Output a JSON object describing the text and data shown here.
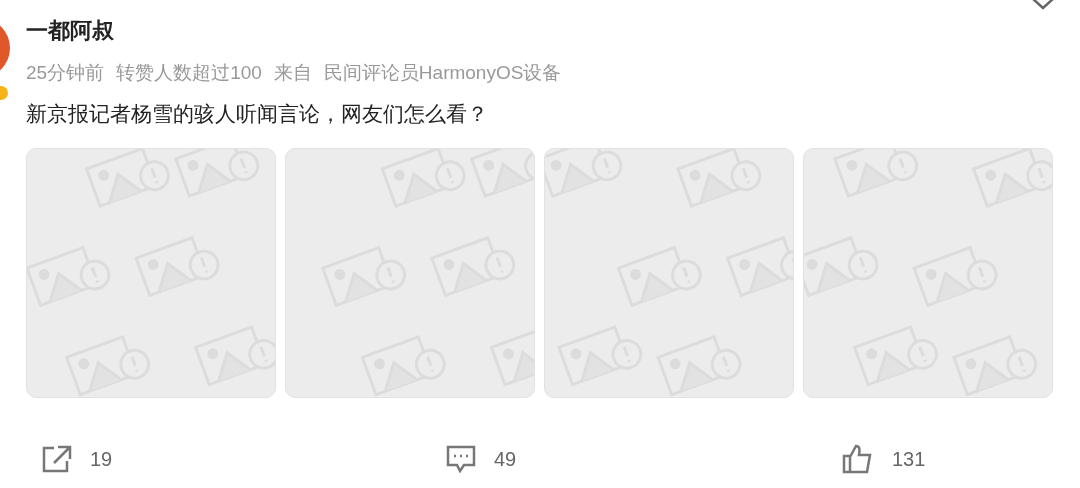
{
  "post": {
    "author": "一都阿叔",
    "meta": [
      "25分钟前",
      "转赞人数超过100",
      "来自",
      "民间评论员HarmonyOS设备"
    ],
    "text": "新京报记者杨雪的骇人听闻言论，网友们怎么看？",
    "images": [
      {
        "kind": "placeholder"
      },
      {
        "kind": "placeholder"
      },
      {
        "kind": "placeholder"
      },
      {
        "kind": "placeholder"
      }
    ],
    "actions": [
      {
        "kind": "share",
        "count": "19"
      },
      {
        "kind": "comment",
        "count": "49"
      },
      {
        "kind": "like",
        "count": "131"
      }
    ]
  }
}
